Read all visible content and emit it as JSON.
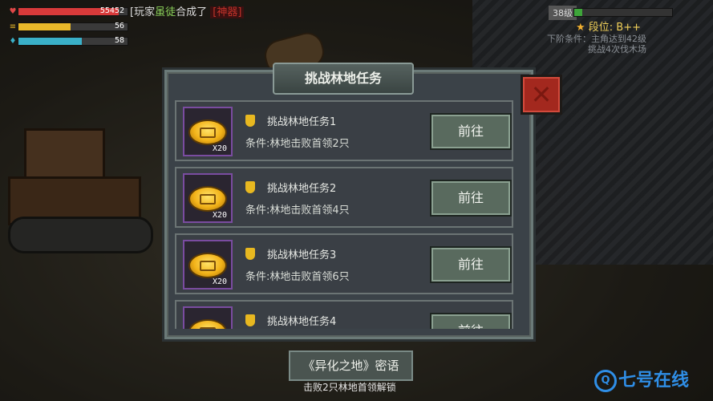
{
  "hud": {
    "hp": {
      "icon": "heart-icon",
      "value": "55452",
      "fill_pct": 92,
      "color": "#d83a3a"
    },
    "energy": {
      "icon": "coin-stack-icon",
      "value": "56",
      "fill_pct": 48,
      "color": "#e8b82a"
    },
    "mana": {
      "icon": "drop-icon",
      "value": "58",
      "fill_pct": 58,
      "color": "#3ab0c8"
    }
  },
  "chat": {
    "prefix": "[玩家",
    "player": "虽徒",
    "suffix": "合成了",
    "item": "[神器]"
  },
  "player": {
    "level": "38级",
    "xp_pct": 8,
    "rank": "段位: B++",
    "next_label": "下阶条件：主角达到42级",
    "next_task": "挑战4次伐木场"
  },
  "modal": {
    "title": "挑战林地任务",
    "tasks": [
      {
        "name": "挑战林地任务1",
        "condition": "条件:林地击败首领2只",
        "reward_qty": "X20",
        "button": "前往"
      },
      {
        "name": "挑战林地任务2",
        "condition": "条件:林地击败首领4只",
        "reward_qty": "X20",
        "button": "前往"
      },
      {
        "name": "挑战林地任务3",
        "condition": "条件:林地击败首领6只",
        "reward_qty": "X20",
        "button": "前往"
      },
      {
        "name": "挑战林地任务4",
        "condition": "",
        "reward_qty": "",
        "button": "前往"
      }
    ]
  },
  "secret": {
    "button": "《异化之地》密语",
    "unlock_text": "击败2只林地首领解锁"
  },
  "watermark": "七号在线"
}
